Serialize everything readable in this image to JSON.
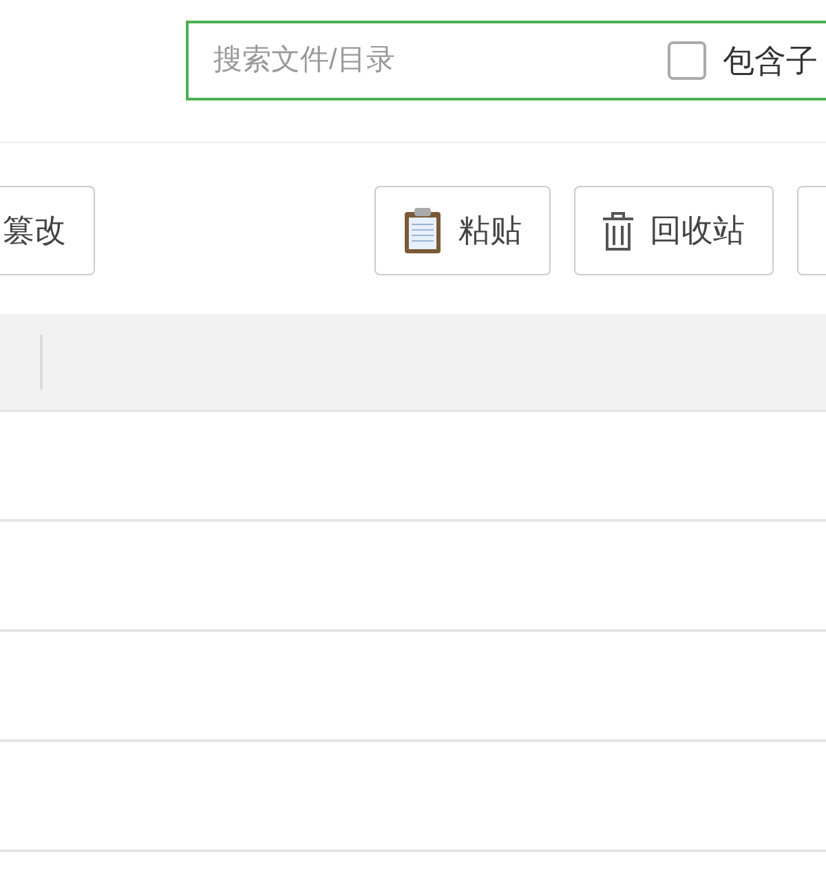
{
  "search": {
    "placeholder": "搜索文件/目录"
  },
  "include_subdirs": {
    "label": "包含子",
    "checked": false
  },
  "toolbar": [
    {
      "kind": "text",
      "label": "篡改"
    },
    {
      "kind": "spacer"
    },
    {
      "kind": "paste",
      "label": "粘贴"
    },
    {
      "kind": "trash",
      "label": "回收站"
    },
    {
      "kind": "blank"
    }
  ]
}
